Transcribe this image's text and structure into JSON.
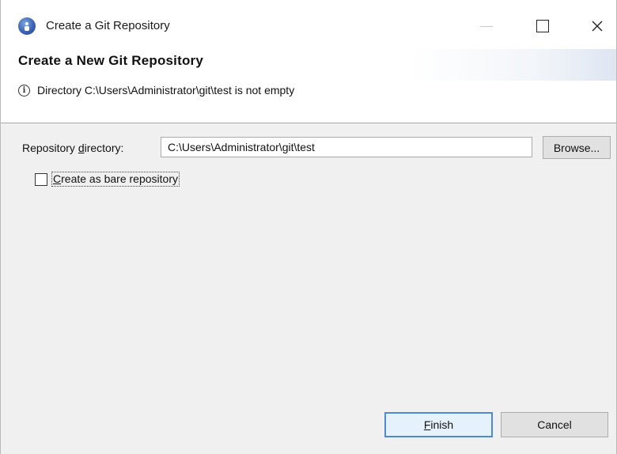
{
  "window": {
    "title": "Create a Git Repository",
    "minimize_label": "—",
    "close_label": "✕"
  },
  "header": {
    "title": "Create a New Git Repository",
    "info_icon": "i",
    "message": "Directory C:\\Users\\Administrator\\git\\test is not empty"
  },
  "form": {
    "repo_label_prefix": "Repository ",
    "repo_label_mnemonic": "d",
    "repo_label_rest": "irectory:",
    "repo_value": "C:\\Users\\Administrator\\git\\test",
    "browse_label": "Browse...",
    "bare_mnemonic": "C",
    "bare_rest": "reate as bare repository",
    "bare_checked": false
  },
  "footer": {
    "finish_mnemonic": "F",
    "finish_rest": "inish",
    "cancel_label": "Cancel"
  },
  "colors": {
    "body_bg": "#f0f0f0",
    "default_button_border": "#4e8ad3",
    "default_button_bg": "#e5f1fb"
  }
}
